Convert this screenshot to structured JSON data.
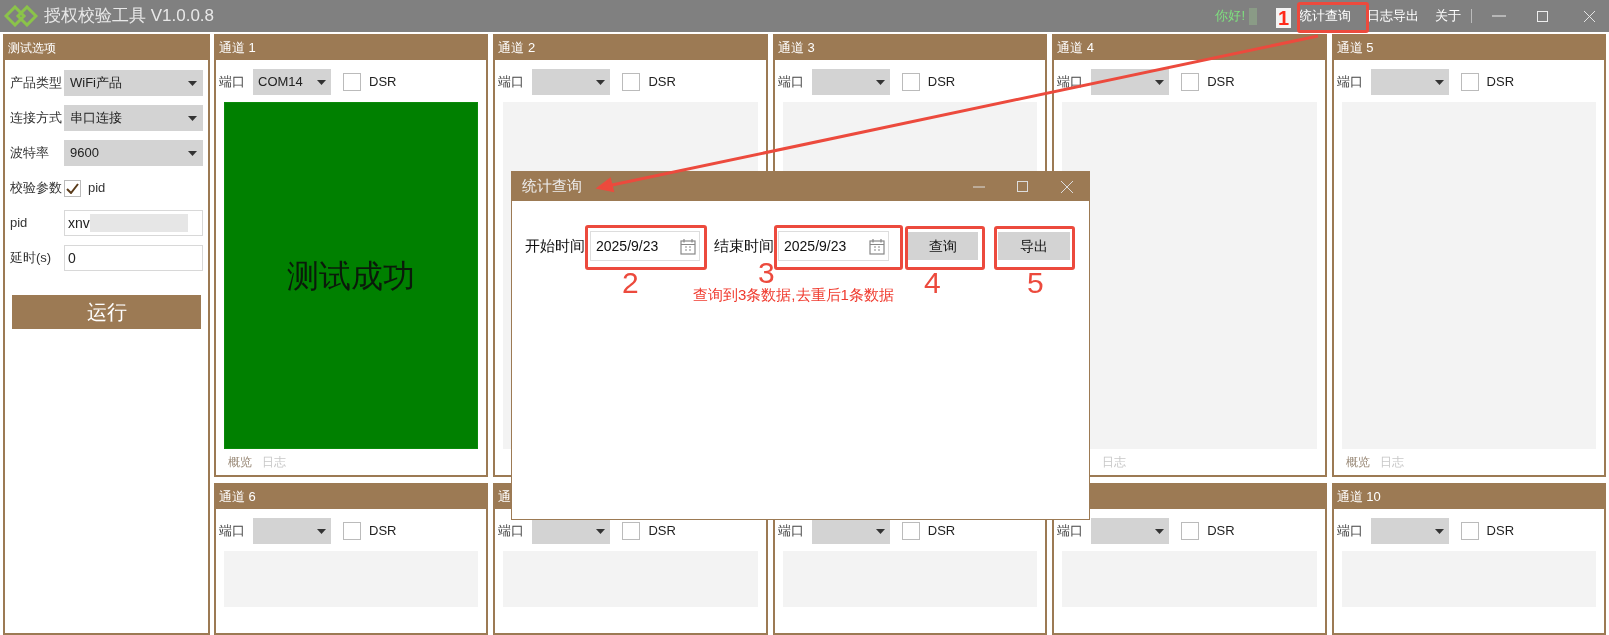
{
  "app": {
    "title": "授权校验工具 V1.0.0.8"
  },
  "top_bar": {
    "greeting": "你好!",
    "name_redacted": true,
    "menu": [
      {
        "label": "统计查询"
      },
      {
        "label": "日志导出"
      },
      {
        "label": "关于"
      }
    ]
  },
  "options_panel": {
    "title": "测试选项",
    "run_button": "运行",
    "fields": [
      {
        "kind": "select",
        "label": "产品类型",
        "value": "WiFi产品"
      },
      {
        "kind": "select",
        "label": "连接方式",
        "value": "串口连接"
      },
      {
        "kind": "select",
        "label": "波特率",
        "value": "9600"
      },
      {
        "kind": "checkbox",
        "label": "校验参数",
        "option": "pid",
        "checked": true
      },
      {
        "kind": "input",
        "label": "pid",
        "value": "xnv",
        "redacted": true
      },
      {
        "kind": "input",
        "label": "延时(s)",
        "value": "0"
      }
    ]
  },
  "channels": [
    {
      "title": "通道 1",
      "port_label": "端口",
      "port": "COM14",
      "dsr_label": "DSR",
      "dsr_checked": false,
      "kind": "success",
      "status_text": "测试成功",
      "tabs": [
        {
          "label": "概览",
          "selected": true
        },
        {
          "label": "日志",
          "selected": false
        }
      ]
    },
    {
      "title": "通道 2",
      "port_label": "端口",
      "dsr_label": "DSR",
      "dsr_checked": false,
      "kind": "idle"
    },
    {
      "title": "通道 3",
      "port_label": "端口",
      "dsr_label": "DSR",
      "dsr_checked": false,
      "kind": "idle"
    },
    {
      "title": "通道 4",
      "port_label": "端口",
      "dsr_label": "DSR",
      "dsr_checked": false,
      "kind": "idle",
      "tabs": [
        {
          "label": "日志",
          "selected": false
        }
      ]
    },
    {
      "title": "通道 5",
      "port_label": "端口",
      "dsr_label": "DSR",
      "dsr_checked": false,
      "kind": "idle",
      "tabs": [
        {
          "label": "概览",
          "selected": true
        },
        {
          "label": "日志",
          "selected": false
        }
      ]
    },
    {
      "title": "通道 6",
      "port_label": "端口",
      "dsr_label": "DSR",
      "dsr_checked": false,
      "kind": "idle"
    },
    {
      "title": "通",
      "port_label": "端口",
      "dsr_label": "DSR",
      "dsr_checked": false,
      "kind": "idle"
    },
    {
      "header_shown": false,
      "port_label": "端口",
      "dsr_label": "DSR",
      "dsr_checked": false,
      "kind": "idle"
    },
    {
      "port_label": "端口",
      "dsr_label": "DSR",
      "dsr_checked": false,
      "kind": "idle"
    },
    {
      "title": "通道 10",
      "port_label": "端口",
      "dsr_label": "DSR",
      "dsr_checked": false,
      "kind": "idle"
    }
  ],
  "dialog": {
    "title": "统计查询",
    "start_label": "开始时间",
    "start_date": "2025/9/23",
    "end_label": "结束时间",
    "end_date": "2025/9/23",
    "query_button": "查询",
    "export_button": "导出",
    "message": "查询到3条数据,去重后1条数据"
  },
  "annotations": [
    {
      "label": "1"
    },
    {
      "label": "2"
    },
    {
      "label": "3"
    },
    {
      "label": "4"
    },
    {
      "label": "5"
    }
  ]
}
